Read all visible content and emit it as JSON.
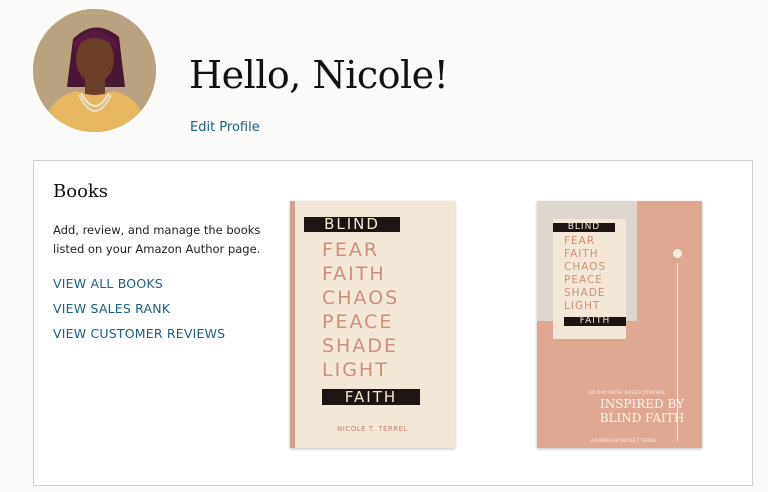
{
  "header": {
    "greeting": "Hello, Nicole!",
    "edit_profile": "Edit Profile"
  },
  "books_section": {
    "title": "Books",
    "description": "Add, review, and manage the books listed on your Amazon Author page.",
    "links": [
      "VIEW ALL BOOKS",
      "VIEW SALES RANK",
      "VIEW CUSTOMER REVIEWS"
    ]
  },
  "book_covers": [
    {
      "words": [
        "BLIND",
        "FEAR",
        "FAITH",
        "CHAOS",
        "PEACE",
        "SHADE",
        "LIGHT",
        "FAITH"
      ],
      "author": "NICOLE T. TERREL"
    },
    {
      "words": [
        "BLIND",
        "FEAR",
        "FAITH",
        "CHAOS",
        "PEACE",
        "SHADE",
        "LIGHT",
        "FAITH"
      ],
      "author": "NICOLE T. TERREL",
      "series": "60 DAY FAITH BASED JOURNAL",
      "title_line1": "INSPIRED BY",
      "title_line2": "BLIND FAITH",
      "byline": "A JOURNAL BY NICOLE T. TERREL"
    }
  ],
  "colors": {
    "accent_link": "#1d5f7a",
    "cover_cream": "#f3e7d7",
    "cover_pink": "#e0a893"
  }
}
